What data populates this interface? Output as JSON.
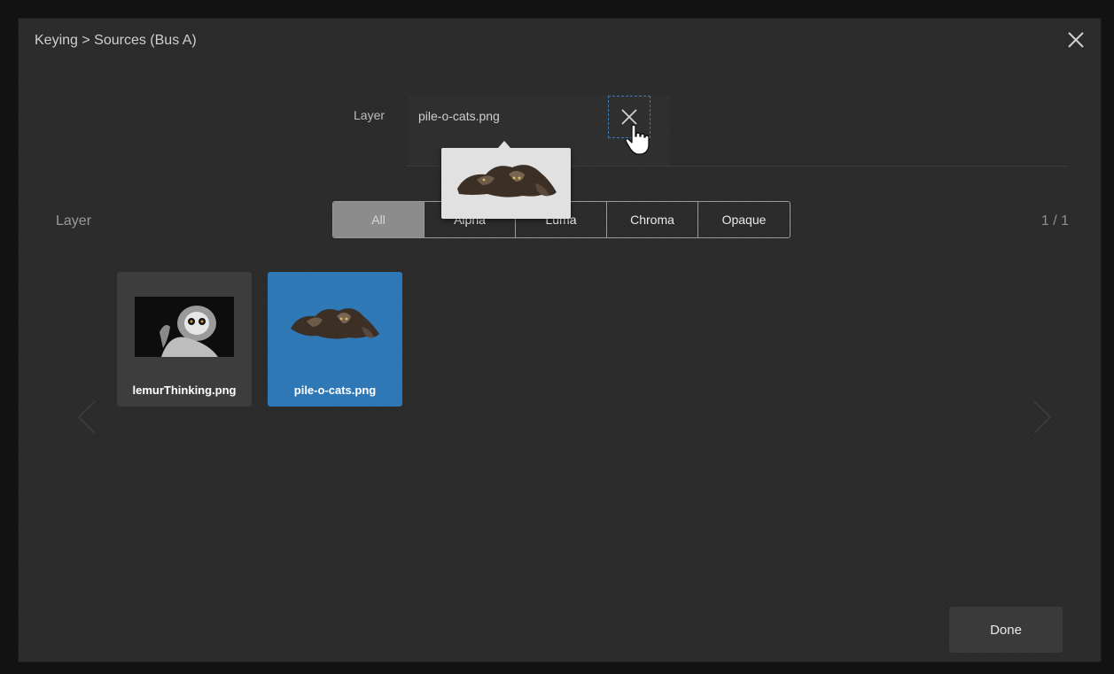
{
  "dialog": {
    "title": "Keying > Sources (Bus A)",
    "close_icon": "close-icon"
  },
  "layer_selector": {
    "label": "Layer",
    "value": "pile-o-cats.png",
    "clear_icon": "close-icon",
    "preview_image": "pile-o-cats thumbnail"
  },
  "browser": {
    "section_label": "Layer",
    "filters": [
      {
        "label": "All",
        "active": true
      },
      {
        "label": "Alpha",
        "active": false
      },
      {
        "label": "Luma",
        "active": false
      },
      {
        "label": "Chroma",
        "active": false
      },
      {
        "label": "Opaque",
        "active": false
      }
    ],
    "page_indicator": "1 / 1",
    "items": [
      {
        "label": "lemurThinking.png",
        "selected": false
      },
      {
        "label": "pile-o-cats.png",
        "selected": true
      }
    ]
  },
  "footer": {
    "done_label": "Done"
  },
  "colors": {
    "accent": "#2f78b6",
    "dialog_bg": "#2b2b2b",
    "active_filter": "#8c8c8c"
  }
}
